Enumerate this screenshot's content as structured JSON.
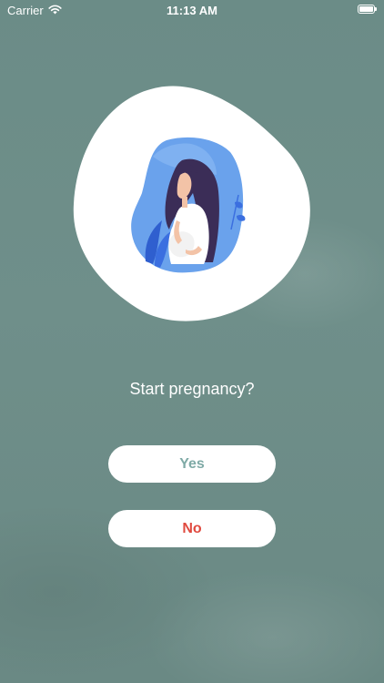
{
  "status_bar": {
    "carrier": "Carrier",
    "time": "11:13 AM",
    "wifi_icon": "wifi-icon",
    "battery_icon": "battery-icon"
  },
  "illustration": {
    "icon": "pregnant-woman-illustration",
    "colors": {
      "blob": "#ffffff",
      "hair": "#3b2d57",
      "skin": "#f3c3a7",
      "dress": "#ffffff",
      "background_blue": "#5d95e8"
    }
  },
  "prompt": {
    "question": "Start pregnancy?"
  },
  "buttons": {
    "yes_label": "Yes",
    "no_label": "No"
  },
  "colors": {
    "background": "#6b8c87",
    "yes_text": "#7faaa6",
    "no_text": "#e04a3f"
  }
}
